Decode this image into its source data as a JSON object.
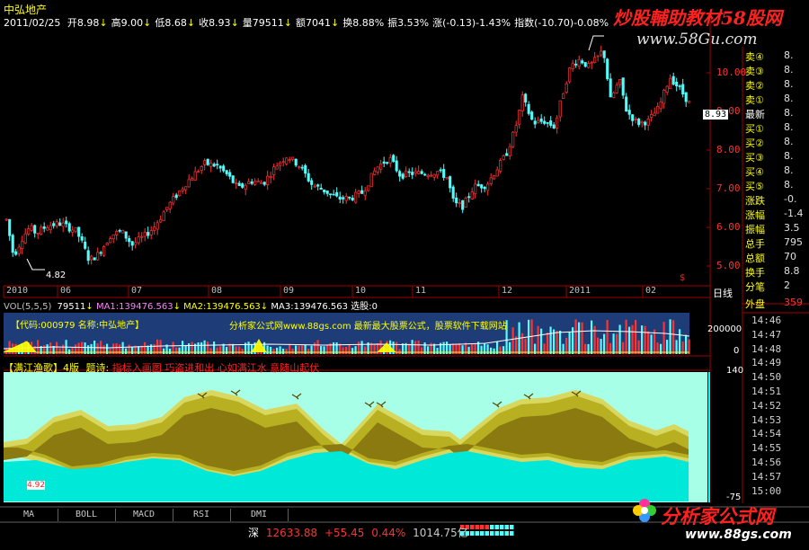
{
  "header": {
    "stock_name": "中弘地产",
    "date": "2011/02/25",
    "stats": [
      {
        "label": "开",
        "value": "8.98",
        "arrow": "↓"
      },
      {
        "label": "高",
        "value": "9.00",
        "arrow": "↓"
      },
      {
        "label": "低",
        "value": "8.68",
        "arrow": "↓"
      },
      {
        "label": "收",
        "value": "8.93",
        "arrow": "↓"
      },
      {
        "label": "量",
        "value": "79511",
        "arrow": "↓"
      },
      {
        "label": "额",
        "value": "7041",
        "arrow": "↓"
      },
      {
        "label": "换",
        "value": "8.88%",
        "arrow": ""
      },
      {
        "label": "振",
        "value": "3.53%",
        "arrow": ""
      },
      {
        "label": "涨",
        "value": "(-0.13)-1.43%",
        "arrow": ""
      },
      {
        "label": "指数",
        "value": "(-10.70)-0.08%",
        "arrow": ""
      }
    ],
    "watermark_line1": "炒股輔助教材58股网",
    "watermark_line2": "www.58Gu.com",
    "colors": {
      "up": "#ff3232",
      "down": "#54fcfc",
      "label": "#ffff00",
      "white": "#ffffff"
    }
  },
  "price_axis": {
    "labels": [
      "10.00",
      "9.00",
      "8.00",
      "7.00",
      "6.00",
      "5.00"
    ],
    "current_price": "8.93",
    "low_marker": "4.82"
  },
  "time_axis": {
    "labels": [
      "2010",
      "06",
      "07",
      "08",
      "09",
      "10",
      "11",
      "12",
      "2011",
      "02"
    ],
    "period": "日线"
  },
  "volume": {
    "header": {
      "vol_label": "VOL(5,5,5)",
      "vol_value": "79511",
      "ma1": "MA1:139476.563",
      "ma2": "MA2:139476.563",
      "ma3": "MA3:139476.563",
      "extra": "选股:0"
    },
    "overlay_code": "【代码:000979 名称:中弘地产】",
    "overlay_ad": "分析家公式网www.88gs.com 最新最大股票公式，股票软件下载网站",
    "axis_labels": [
      "200000",
      "0"
    ]
  },
  "indicator": {
    "title": "【满江渔歌】4版",
    "poem_label": "题诗:",
    "poem": "指标入画图 巧盗进和出 心如满江水 意随山起伏",
    "axis_top": "140",
    "axis_bottom": "-75",
    "small_label": "4.92"
  },
  "quote_panel": {
    "sell": [
      {
        "label": "卖④",
        "value": "8."
      },
      {
        "label": "卖③",
        "value": "8."
      },
      {
        "label": "卖②",
        "value": "8."
      },
      {
        "label": "卖①",
        "value": "8."
      }
    ],
    "latest": {
      "label": "最新",
      "value": "8."
    },
    "buy": [
      {
        "label": "买①",
        "value": "8."
      },
      {
        "label": "买②",
        "value": "8."
      },
      {
        "label": "买③",
        "value": "8."
      },
      {
        "label": "买④",
        "value": "8."
      },
      {
        "label": "买⑤",
        "value": "8."
      }
    ],
    "stats": [
      {
        "label": "涨跌",
        "value": "-0."
      },
      {
        "label": "涨幅",
        "value": "-1.4"
      },
      {
        "label": "振幅",
        "value": "3.5"
      },
      {
        "label": "总手",
        "value": "795"
      },
      {
        "label": "总额",
        "value": "70"
      },
      {
        "label": "换手",
        "value": "8.8"
      },
      {
        "label": "分笔",
        "value": "2"
      }
    ],
    "outer": {
      "label": "外盘",
      "value": "359"
    },
    "times": [
      "14:46",
      "14:47",
      "14:48",
      "14:49",
      "14:50",
      "14:51",
      "14:52",
      "14:53",
      "14:54",
      "14:55",
      "14:56",
      "14:57",
      "15:00"
    ]
  },
  "tabs": [
    "MA",
    "BOLL",
    "MACD",
    "RSI",
    "DMI"
  ],
  "status_bar": {
    "market": "深",
    "index": "12633.88",
    "change": "+55.45",
    "pct": "0.44%",
    "amount": "1014.75亿"
  },
  "logo": {
    "text": "分析家公式网",
    "url": "www.88gs.com"
  }
}
